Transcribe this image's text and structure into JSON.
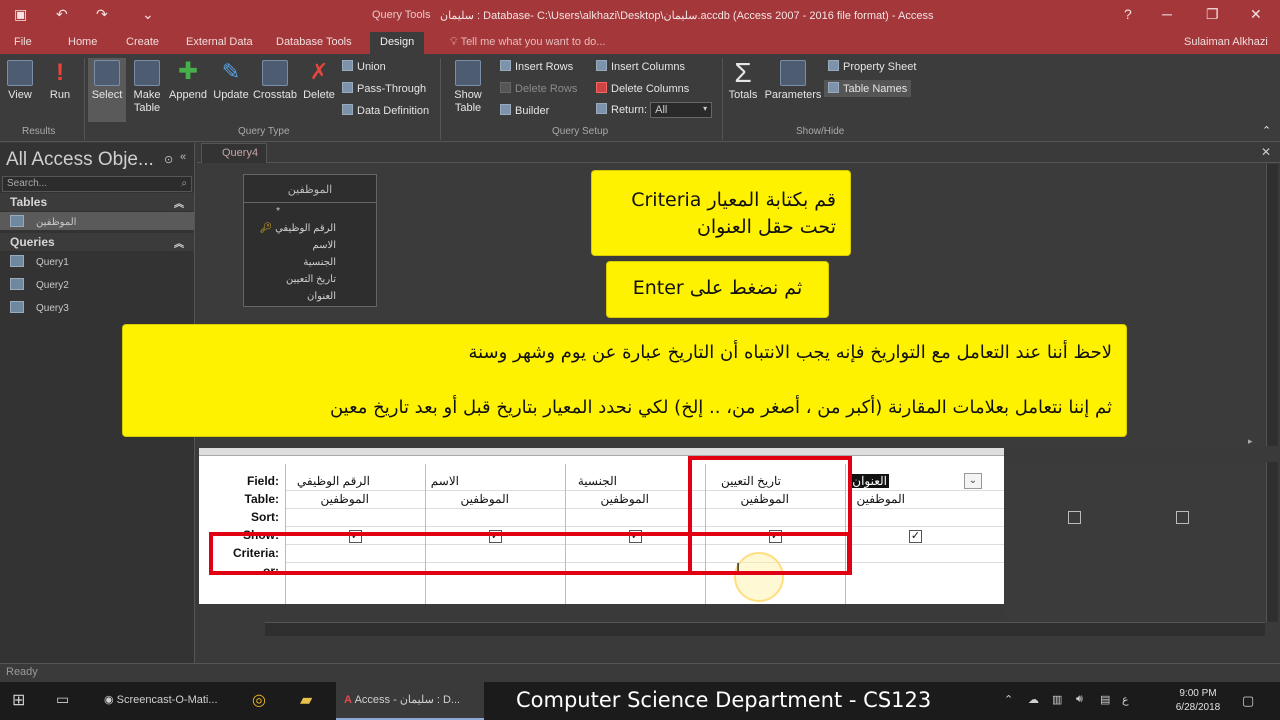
{
  "colors": {
    "titlebar": "#a4373a",
    "callout": "#fff200",
    "highlight": "#e00012"
  },
  "window": {
    "context_tab": "Query Tools",
    "title": "سليمان : Database- C:\\Users\\alkhazi\\Desktop\\سليمان.accdb (Access 2007 - 2016 file format) - Access",
    "help": "?"
  },
  "tabs": [
    "File",
    "Home",
    "Create",
    "External Data",
    "Database Tools",
    "Design"
  ],
  "tell_me": "Tell me what you want to do...",
  "user": "Sulaiman Alkhazi",
  "ribbon": {
    "results": {
      "view": "View",
      "run": "Run",
      "label": "Results"
    },
    "query_type": {
      "select": "Select",
      "make_table_1": "Make",
      "make_table_2": "Table",
      "append": "Append",
      "update": "Update",
      "crosstab": "Crosstab",
      "delete": "Delete",
      "union": "Union",
      "pass_through": "Pass-Through",
      "data_definition": "Data Definition",
      "label": "Query Type"
    },
    "query_setup": {
      "show_table_1": "Show",
      "show_table_2": "Table",
      "insert_rows": "Insert Rows",
      "delete_rows": "Delete Rows",
      "builder": "Builder",
      "insert_columns": "Insert Columns",
      "delete_columns": "Delete Columns",
      "return_label": "Return:",
      "return_value": "All",
      "label": "Query Setup"
    },
    "show_hide": {
      "totals": "Totals",
      "parameters": "Parameters",
      "property_sheet": "Property Sheet",
      "table_names": "Table Names",
      "label": "Show/Hide"
    }
  },
  "nav": {
    "title": "All Access Obje...",
    "search_placeholder": "Search...",
    "tables_header": "Tables",
    "tables": [
      "الموظفين"
    ],
    "queries_header": "Queries",
    "queries": [
      "Query1",
      "Query2",
      "Query3"
    ]
  },
  "doc_tab": "Query4",
  "table_box": {
    "name": "الموظفين",
    "fields": [
      "*",
      "الرقم الوظيفي",
      "الاسم",
      "الجنسية",
      "تاريخ التعيين",
      "العنوان"
    ]
  },
  "callouts": {
    "c1_line1": "قم بكتابة المعيار Criteria",
    "c1_line2": "تحت حقل العنوان",
    "c2": "ثم نضغط على Enter",
    "c3_line1": "لاحظ أننا عند التعامل مع التواريخ فإنه يجب الانتباه أن التاريخ عبارة عن يوم وشهر وسنة",
    "c3_line2": "ثم إننا نتعامل بعلامات المقارنة (أكبر من ، أصغر من، .. إلخ) لكي نحدد المعيار بتاريخ قبل أو بعد تاريخ معين"
  },
  "grid": {
    "row_labels": [
      "Field:",
      "Table:",
      "Sort:",
      "Show:",
      "Criteria:",
      "or:"
    ],
    "columns": [
      {
        "field": "الرقم الوظيفي",
        "table": "الموظفين"
      },
      {
        "field": "الاسم",
        "table": "الموظفين"
      },
      {
        "field": "الجنسية",
        "table": "الموظفين"
      },
      {
        "field": "تاريخ التعيين",
        "table": "الموظفين"
      },
      {
        "field": "العنوان",
        "table": "الموظفين"
      }
    ],
    "check": "✓"
  },
  "status": "Ready",
  "taskbar": {
    "screencast": "Screencast-O-Mati...",
    "access": "Access - سليمان : D...",
    "caption": "Computer Science Department - CS123",
    "time": "9:00 PM",
    "date": "6/28/2018",
    "lang": "ع"
  }
}
